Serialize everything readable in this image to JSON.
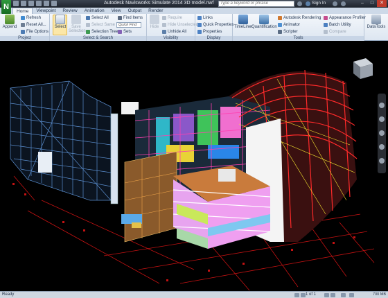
{
  "titlebar": {
    "app_letter": "N",
    "title": "Autodesk Navisworks Simulate 2014   3D model.nwf",
    "search_placeholder": "Type a keyword or phrase",
    "sign_in": "Sign In",
    "minimize": "–",
    "maximize": "□",
    "close": "✕"
  },
  "tabs": [
    "Home",
    "Viewpoint",
    "Review",
    "Animation",
    "View",
    "Output",
    "Render"
  ],
  "ribbon": {
    "project": {
      "title": "Project",
      "append": "Append",
      "refresh": "Refresh",
      "reset_all": "Reset All...",
      "file_options": "File Options"
    },
    "select_search": {
      "title": "Select & Search",
      "select": "Select",
      "save_selection": "Save Selection",
      "select_all": "Select All",
      "select_same": "Select Same",
      "selection_tree": "Selection Tree",
      "find_items": "Find Items",
      "quick_find": "Quick Find",
      "sets": "Sets"
    },
    "visibility": {
      "title": "Visibility",
      "hide": "Hide",
      "require": "Require",
      "hide_unselected": "Hide Unselected",
      "unhide_all": "Unhide All"
    },
    "display": {
      "title": "Display",
      "links": "Links",
      "quick_properties": "Quick Properties",
      "properties": "Properties"
    },
    "tools": {
      "title": "Tools",
      "timeliner": "TimeLiner",
      "quantification": "Quantification",
      "autodesk_rendering": "Autodesk Rendering",
      "animator": "Animator",
      "scripter": "Scripter",
      "appearance_profiler": "Appearance Profiler",
      "batch_utility": "Batch Utility",
      "compare": "Compare",
      "datatools": "DataTools"
    }
  },
  "statusbar": {
    "status": "Ready",
    "page": "1 of 1",
    "memory": "700 MB"
  }
}
